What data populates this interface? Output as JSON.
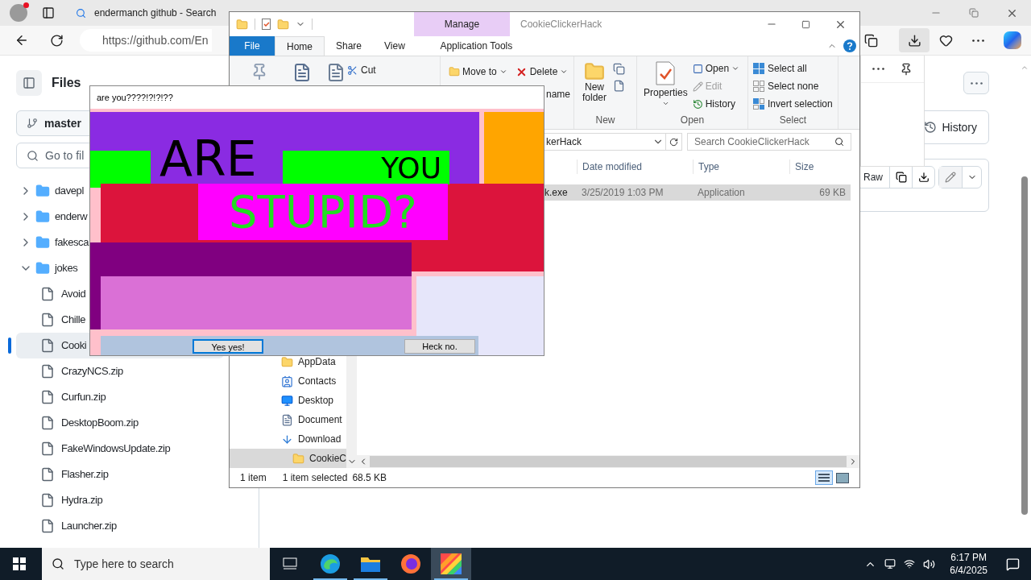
{
  "browser": {
    "tab_title": "endermanch github - Search",
    "address": "https://github.com/En"
  },
  "github": {
    "title": "Files",
    "branch": "master",
    "search_placeholder": "Go to fil",
    "tree": [
      {
        "name": "davepl",
        "expanded": false,
        "selected": false
      },
      {
        "name": "enderw",
        "expanded": false,
        "selected": false
      },
      {
        "name": "fakesca",
        "expanded": false,
        "selected": false
      },
      {
        "name": "jokes",
        "expanded": true,
        "selected": false,
        "children": [
          {
            "name": "Avoid",
            "selected": false
          },
          {
            "name": "Chille",
            "selected": false
          },
          {
            "name": "Cooki",
            "selected": true
          },
          {
            "name": "CrazyNCS.zip",
            "selected": false
          },
          {
            "name": "Curfun.zip",
            "selected": false
          },
          {
            "name": "DesktopBoom.zip",
            "selected": false
          },
          {
            "name": "FakeWindowsUpdate.zip",
            "selected": false
          },
          {
            "name": "Flasher.zip",
            "selected": false
          },
          {
            "name": "Hydra.zip",
            "selected": false
          },
          {
            "name": "Launcher.zip",
            "selected": false
          }
        ]
      }
    ],
    "history_button": "History",
    "raw_button": "Raw"
  },
  "explorer": {
    "title": "CookieClickerHack",
    "context_group": "Manage",
    "file_tab": "File",
    "tabs": [
      {
        "label": "Home",
        "selected": true
      },
      {
        "label": "Share",
        "selected": false
      },
      {
        "label": "View",
        "selected": false
      },
      {
        "label": "Application Tools",
        "selected": false
      }
    ],
    "ribbon": {
      "cut": "Cut",
      "move_to": "Move to",
      "delete": "Delete",
      "rename": "name",
      "new_folder": "New folder",
      "properties": "Properties",
      "open": "Open",
      "edit": {
        "label": "Edit",
        "disabled": true
      },
      "history": "History",
      "select_all": "Select all",
      "select_none": "Select none",
      "invert_selection": "Invert selection",
      "groups": [
        "New",
        "Open",
        "Select"
      ]
    },
    "address": "kerHack",
    "search_placeholder": "Search CookieClickerHack",
    "columns": [
      "Date modified",
      "Type",
      "Size"
    ],
    "rows": [
      {
        "name": "k.exe",
        "date_modified": "3/25/2019 1:03 PM",
        "type": "Application",
        "size": "69 KB",
        "selected": true
      }
    ],
    "nav": [
      {
        "label": "AppData",
        "kind": "folder",
        "selected": false
      },
      {
        "label": "Contacts",
        "kind": "contacts",
        "selected": false
      },
      {
        "label": "Desktop",
        "kind": "desktop",
        "selected": false
      },
      {
        "label": "Document",
        "kind": "documents",
        "selected": false
      },
      {
        "label": "Download",
        "kind": "downloads",
        "selected": false
      },
      {
        "label": "CookieC",
        "kind": "folder",
        "selected": true
      }
    ],
    "status": {
      "count": "1 item",
      "selection": "1 item selected",
      "size": "68.5 KB"
    }
  },
  "popup": {
    "title": "are you????!?!?!??",
    "words": [
      "ARE",
      "YOU",
      "STUPID?"
    ],
    "buttons": [
      {
        "label": "Yes yes!",
        "focused": true
      },
      {
        "label": "Heck no.",
        "focused": false
      }
    ]
  },
  "taskbar": {
    "search_placeholder": "Type here to search",
    "apps": [
      {
        "kind": "taskview",
        "running": false,
        "selected": false
      },
      {
        "kind": "edge",
        "running": true,
        "selected": false
      },
      {
        "kind": "explorer",
        "running": true,
        "selected": false
      },
      {
        "kind": "firefox",
        "running": false,
        "selected": false
      },
      {
        "kind": "paint",
        "running": true,
        "selected": true
      }
    ],
    "time": "6:17 PM",
    "date": "6/4/2025"
  }
}
